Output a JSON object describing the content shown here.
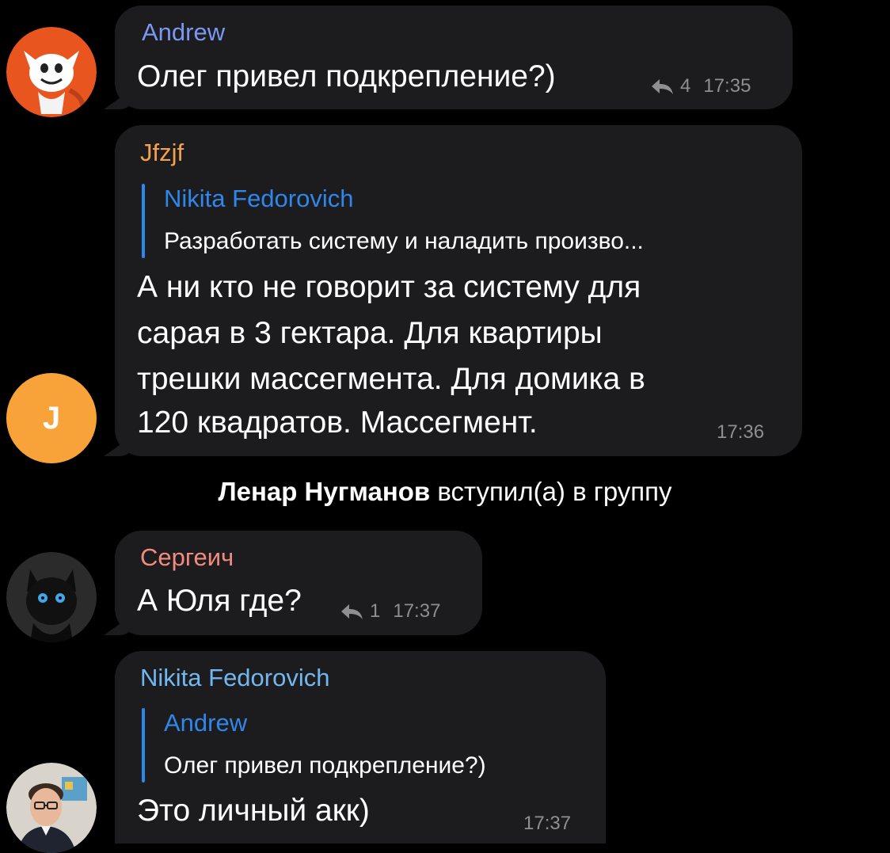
{
  "messages": [
    {
      "sender": "Andrew",
      "sender_color": "#7b97f2",
      "text": "Олег привел подкрепление?)",
      "reply_count": "4",
      "time": "17:35",
      "avatar_icon": "fox-avatar-icon"
    },
    {
      "sender": "Jfzjf",
      "sender_color": "#f2a14c",
      "reply_to": {
        "name": "Nikita Fedorovich",
        "text": "Разработать систему и наладить произво..."
      },
      "lines": [
        "А ни кто не говорит за систему для",
        "сарая в 3 гектара. Для квартиры",
        "трешки массегмента. Для домика в",
        "120 квадратов. Массегмент."
      ],
      "time": "17:36",
      "avatar_letter": "J",
      "avatar_color": "#f7a33a"
    },
    {
      "sender": "Сергеич",
      "sender_color": "#f28b7d",
      "text": "А Юля где?",
      "reply_count": "1",
      "time": "17:37",
      "avatar_icon": "black-cat-avatar-icon"
    },
    {
      "sender": "Nikita Fedorovich",
      "sender_color": "#73b7f0",
      "reply_to": {
        "name": "Andrew",
        "text": "Олег привел подкрепление?)"
      },
      "text": "Это личный акк)",
      "time": "17:37",
      "avatar_icon": "man-with-glasses-avatar-icon"
    }
  ],
  "service_message": {
    "name": "Ленар Нугманов",
    "action": "вступил(а) в группу"
  },
  "colors": {
    "background": "#000000",
    "bubble": "#1c1c1e",
    "quote_accent": "#2f86eb",
    "meta_text": "#8e8e93"
  }
}
